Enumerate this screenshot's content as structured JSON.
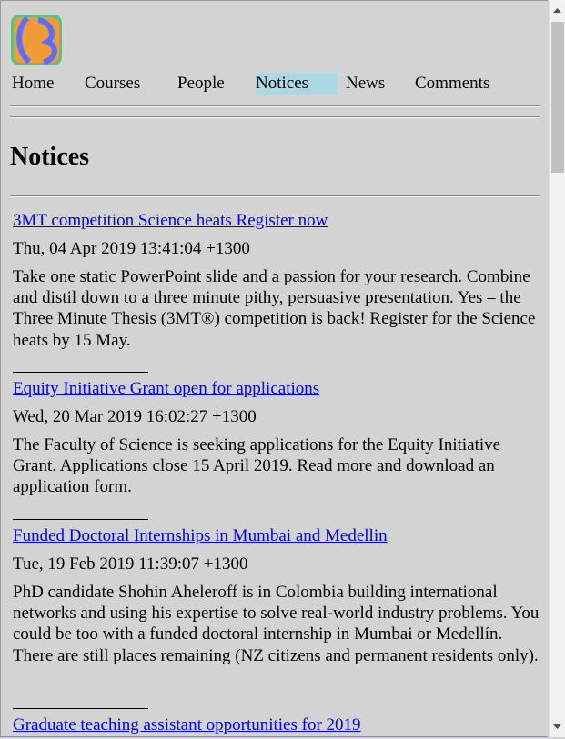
{
  "logo": {
    "icon": "university-logo-icon",
    "colors": [
      "#5a6fff",
      "#f09a3a",
      "#5fbf7f"
    ]
  },
  "nav": {
    "items": [
      "Home",
      "Courses",
      "People",
      "Notices",
      "News",
      "Comments"
    ],
    "active": "Notices"
  },
  "page": {
    "title": "Notices"
  },
  "notices": [
    {
      "title": "3MT competition Science heats Register now",
      "date": "Thu, 04 Apr 2019 13:41:04 +1300",
      "body": "Take one static PowerPoint slide and a passion for your research. Combine and distil down to a three minute pithy, persuasive presentation. Yes – the Three Minute Thesis (3MT®) competition is back! Register for the Science heats by 15 May."
    },
    {
      "title": "Equity Initiative Grant open for applications",
      "date": "Wed, 20 Mar 2019 16:02:27 +1300",
      "body": "The Faculty of Science is seeking applications for the Equity Initiative Grant. Applications close 15 April 2019. Read more and download an application form."
    },
    {
      "title": "Funded Doctoral Internships in Mumbai and Medellin",
      "date": "Tue, 19 Feb 2019 11:39:07 +1300",
      "body": "PhD candidate Shohin Aheleroff is in Colombia building international networks and using his expertise to solve real-world industry problems. You could be too with a funded doctoral internship in Mumbai or Medellín. There are still places remaining (NZ citizens and permanent residents only)."
    },
    {
      "title": "Graduate teaching assistant opportunities for 2019",
      "date": "",
      "body": ""
    }
  ],
  "colors": {
    "background": "#d3d3d3",
    "link": "#0000ee",
    "active_tab": "#add8e6"
  }
}
